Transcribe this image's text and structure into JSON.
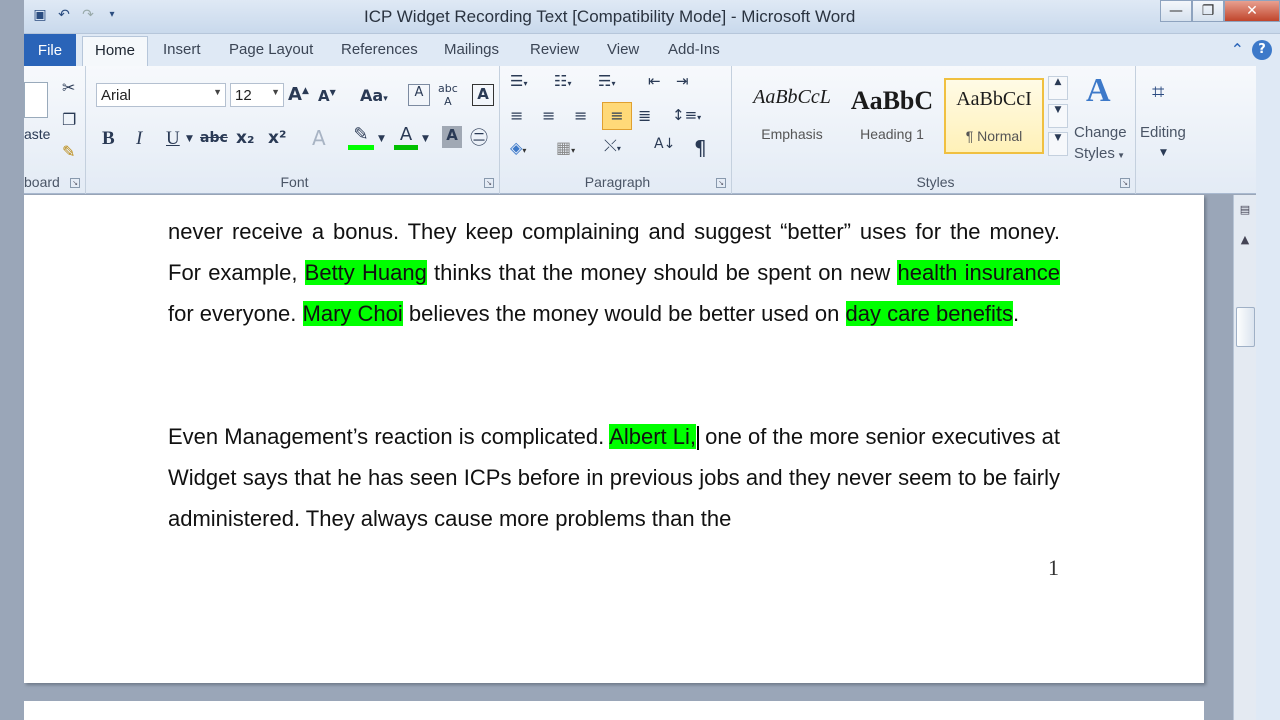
{
  "window": {
    "title": "ICP Widget Recording Text [Compatibility Mode] - Microsoft Word",
    "minimize": "—",
    "maximize": "❐",
    "close": "✕"
  },
  "tabs": [
    "File",
    "Home",
    "Insert",
    "Page Layout",
    "References",
    "Mailings",
    "Review",
    "View",
    "Add-Ins"
  ],
  "ribbon": {
    "clipboard": {
      "paste_label": "aste",
      "group_label": "board"
    },
    "font": {
      "font_name": "Arial",
      "font_size": "12",
      "group_label": "Font",
      "bold": "B",
      "italic": "I",
      "underline": "U",
      "strike": "abc",
      "subscript": "x₂",
      "superscript": "x²",
      "change_case": "Aa"
    },
    "paragraph": {
      "group_label": "Paragraph",
      "pilcrow": "¶"
    },
    "styles": {
      "group_label": "Styles",
      "items": [
        {
          "sample": "AaBbCcL",
          "name": "Emphasis"
        },
        {
          "sample": "AaBbC",
          "name": "Heading 1"
        },
        {
          "sample": "AaBbCcI",
          "name": "¶ Normal"
        }
      ],
      "change_styles_1": "Change",
      "change_styles_2": "Styles"
    },
    "editing": {
      "label": "Editing"
    }
  },
  "document": {
    "para1": {
      "t1": "never receive a bonus. They keep complaining and suggest “better” uses for the money. For example, ",
      "h1": "Betty Huang",
      "t2": " thinks that the money should be spent on new ",
      "h2": "health insurance",
      "t3": " for everyone. ",
      "h3": "Mary Choi",
      "t4": " believes the money would be better used on ",
      "h4": "day care benefits",
      "t5": "."
    },
    "para2": {
      "t1": "Even Management’s reaction is complicated.  ",
      "h1": "Albert Li,",
      "t2": " one of the more senior executives at Widget says that he has seen ICPs before in previous jobs and they never seem to be fairly administered.  They always cause more problems than the"
    },
    "page_number": "1"
  },
  "colors": {
    "highlight": "#00ff00",
    "file_tab": "#2a64b8"
  }
}
